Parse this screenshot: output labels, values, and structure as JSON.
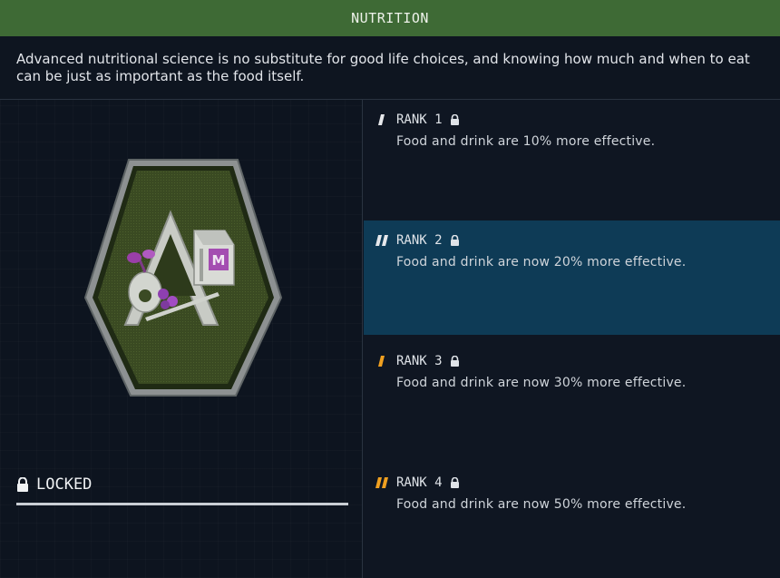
{
  "header": {
    "title": "NUTRITION"
  },
  "description": "Advanced nutritional science is no substitute for good life choices, and knowing how much and when to eat can be just as important as the food itself.",
  "status": {
    "label": "LOCKED",
    "lock_icon": "lock-icon"
  },
  "badge": {
    "letter": "M",
    "icon": "nutrition-badge-icon"
  },
  "colors": {
    "header_bg": "#3e6a35",
    "selected_row": "#0e3b56",
    "rank_mark_white": "#e6e8eb",
    "rank_mark_orange": "#f0a020"
  },
  "ranks": [
    {
      "label": "RANK 1",
      "text": "Food and drink are 10% more effective.",
      "mark": "rank-1-mark-icon",
      "locked": true,
      "selected": false
    },
    {
      "label": "RANK 2",
      "text": "Food and drink are now 20% more effective.",
      "mark": "rank-2-mark-icon",
      "locked": true,
      "selected": true
    },
    {
      "label": "RANK 3",
      "text": "Food and drink are now 30% more effective.",
      "mark": "rank-3-mark-icon",
      "locked": true,
      "selected": false
    },
    {
      "label": "RANK 4",
      "text": "Food and drink are now 50% more effective.",
      "mark": "rank-4-mark-icon",
      "locked": true,
      "selected": false
    }
  ]
}
